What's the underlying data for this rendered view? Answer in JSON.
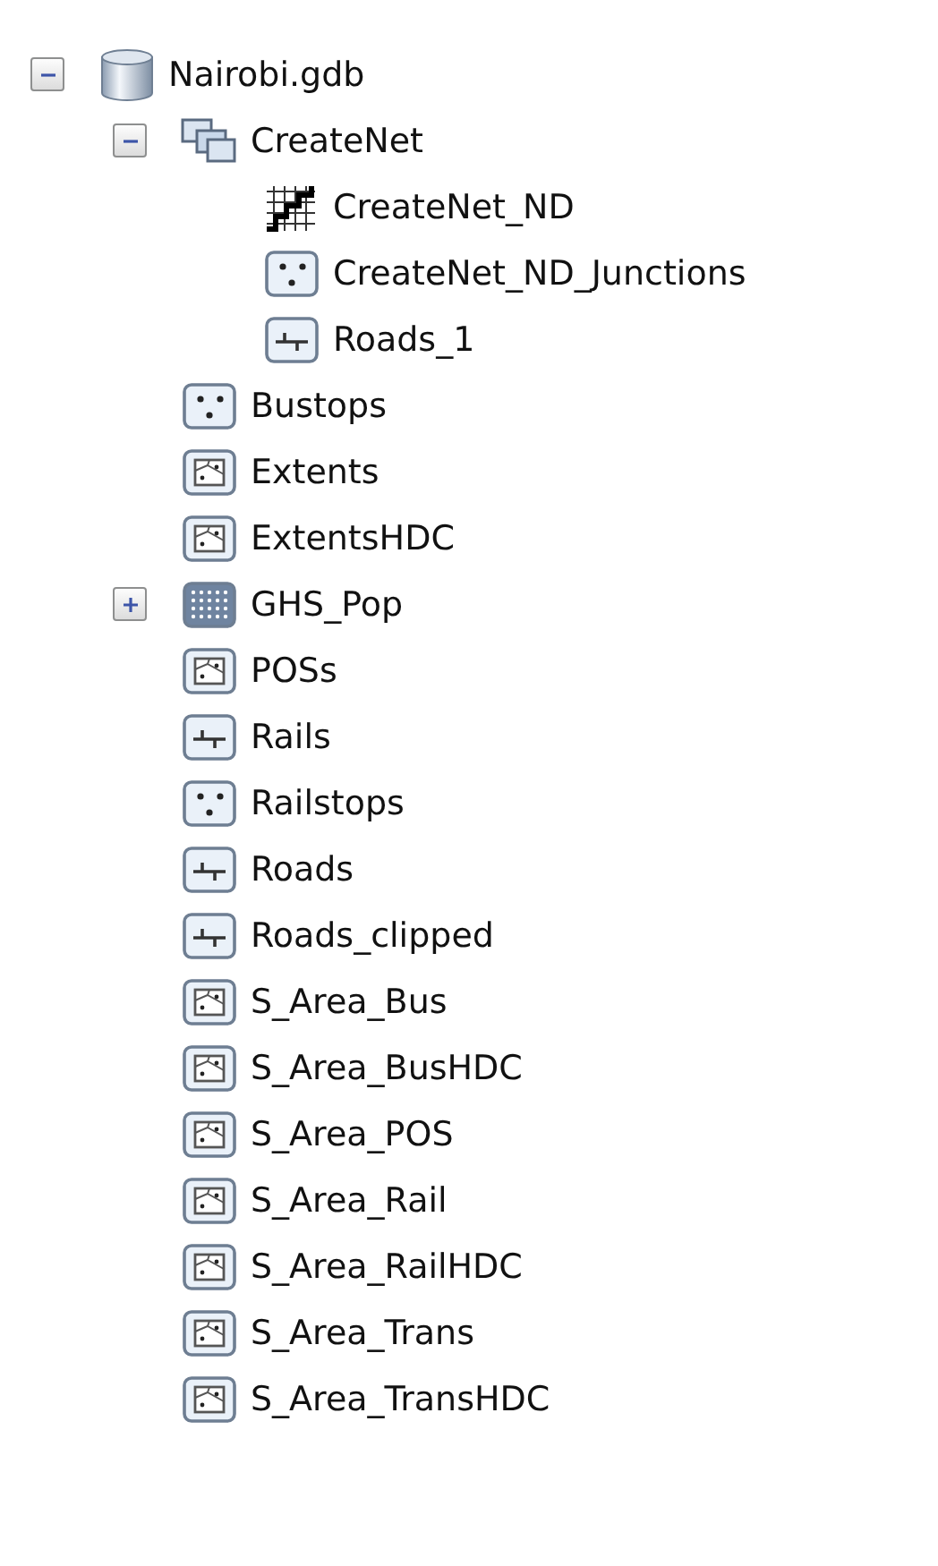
{
  "tree": [
    {
      "label": "Nairobi.gdb",
      "kind": "database",
      "expanded": true,
      "children": [
        {
          "label": "CreateNet",
          "kind": "dataset",
          "expanded": true,
          "children": [
            {
              "label": "CreateNet_ND",
              "kind": "network"
            },
            {
              "label": "CreateNet_ND_Junctions",
              "kind": "point"
            },
            {
              "label": "Roads_1",
              "kind": "line"
            }
          ]
        },
        {
          "label": "Bustops",
          "kind": "point"
        },
        {
          "label": "Extents",
          "kind": "polygon"
        },
        {
          "label": "ExtentsHDC",
          "kind": "polygon"
        },
        {
          "label": "GHS_Pop",
          "kind": "raster",
          "expanded": false
        },
        {
          "label": "POSs",
          "kind": "polygon"
        },
        {
          "label": "Rails",
          "kind": "line"
        },
        {
          "label": "Railstops",
          "kind": "point"
        },
        {
          "label": "Roads",
          "kind": "line"
        },
        {
          "label": "Roads_clipped",
          "kind": "line"
        },
        {
          "label": "S_Area_Bus",
          "kind": "polygon"
        },
        {
          "label": "S_Area_BusHDC",
          "kind": "polygon"
        },
        {
          "label": "S_Area_POS",
          "kind": "polygon"
        },
        {
          "label": "S_Area_Rail",
          "kind": "polygon"
        },
        {
          "label": "S_Area_RailHDC",
          "kind": "polygon"
        },
        {
          "label": "S_Area_Trans",
          "kind": "polygon"
        },
        {
          "label": "S_Area_TransHDC",
          "kind": "polygon"
        }
      ]
    }
  ]
}
